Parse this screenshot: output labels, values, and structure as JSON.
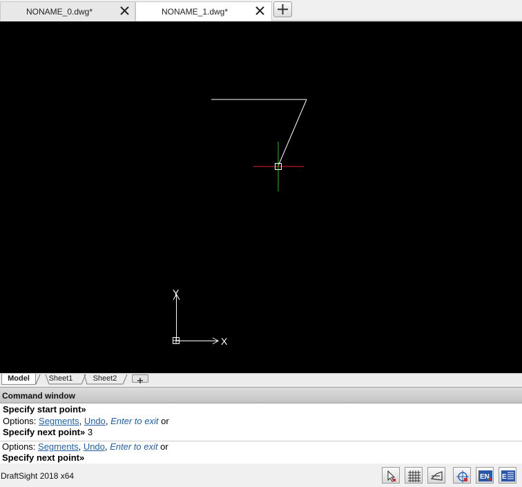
{
  "tabs": [
    {
      "label": "NONAME_0.dwg*",
      "active": false
    },
    {
      "label": "NONAME_1.dwg*",
      "active": true
    }
  ],
  "sheet_tabs": [
    "Model",
    "Sheet1",
    "Sheet2"
  ],
  "ucs": {
    "x_label": "X",
    "y_label": "Y"
  },
  "colors": {
    "canvas": "#000000",
    "cursor_x": "#e02020",
    "cursor_y": "#20c020",
    "keyword": "#1f5fa8"
  },
  "command_window": {
    "title": "Command window",
    "history": [
      {
        "prompt": "Specify start point»",
        "value": ""
      },
      {
        "options_prefix": "Options: ",
        "segments": "Segments",
        "sep1": ", ",
        "undo": "Undo",
        "sep2": ", ",
        "enter_to_exit": "Enter to exit",
        "suffix": " or"
      },
      {
        "prompt": "Specify next point»",
        "value": " 3"
      }
    ],
    "current": {
      "options_prefix": "Options: ",
      "segments": "Segments",
      "sep1": ", ",
      "undo": "Undo",
      "sep2": ", ",
      "enter_to_exit": "Enter to exit",
      "suffix": " or",
      "prompt": "Specify next point»"
    }
  },
  "status": {
    "app_version": "DraftSight 2018 x64",
    "buttons": [
      "select-cursor-icon",
      "grid-icon",
      "ortho-icon",
      "esnap-icon",
      "etrack-icon",
      "properties-icon"
    ]
  }
}
